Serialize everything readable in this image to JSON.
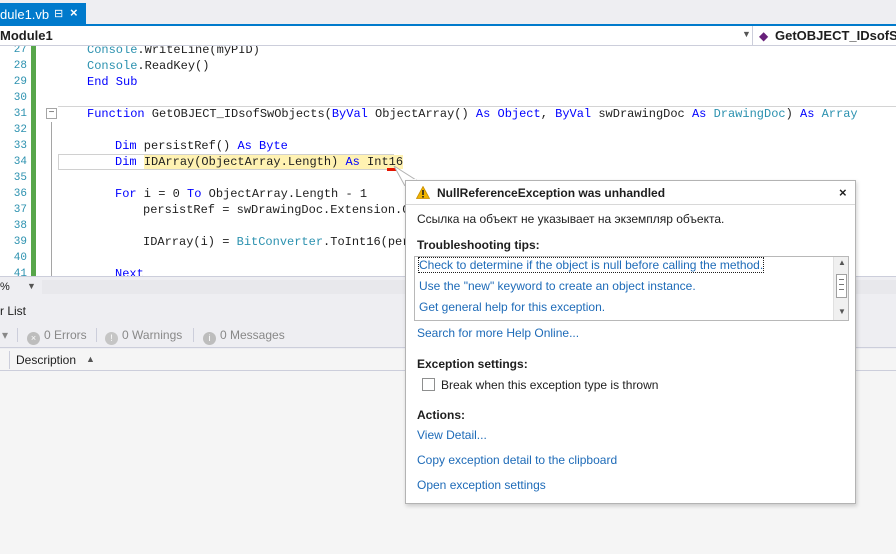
{
  "tab": {
    "title": "dule1.vb",
    "pin": "⊟",
    "close": "×"
  },
  "navbar": {
    "left": "Module1",
    "right": "GetOBJECT_IDsofSwObjects"
  },
  "line_numbers": [
    "27",
    "28",
    "29",
    "30",
    "31",
    "32",
    "33",
    "34",
    "35",
    "36",
    "37",
    "38",
    "39",
    "40",
    "41"
  ],
  "code": {
    "l27": {
      "a": "Console",
      "b": ".WriteLine(myPID)"
    },
    "l28": {
      "a": "Console",
      "b": ".ReadKey()"
    },
    "l29": {
      "a": "End Sub"
    },
    "l31": {
      "k1": "Function",
      "t1": " GetOBJECT_IDsofSwObjects(",
      "k2": "ByVal",
      "t2": " ObjectArray() ",
      "k3": "As",
      "t3": " ",
      "k4": "Object",
      "t4": ", ",
      "k5": "ByVal",
      "t5": " swDrawingDoc ",
      "k6": "As",
      "t6": " ",
      "ty1": "DrawingDoc",
      "t7": ") ",
      "k7": "As",
      "t8": " ",
      "ty2": "Array"
    },
    "l33": {
      "k1": "Dim",
      "t1": " persistRef() ",
      "k2": "As",
      "t2": " ",
      "k3": "Byte"
    },
    "l34": {
      "k1": "Dim",
      "t1": " ",
      "h1": "IDArray(ObjectArray.Length) ",
      "h2": "As",
      "h3": " Int16"
    },
    "l36": {
      "k1": "For",
      "t1": " i = 0 ",
      "k2": "To",
      "t2": " ObjectArray.Length - 1"
    },
    "l37": {
      "t1": "persistRef = swDrawingDoc.Extension.Ge"
    },
    "l39": {
      "t1": "IDArray(i) = ",
      "ty1": "BitConverter",
      "t2": ".ToInt16(pers"
    },
    "l41": {
      "k1": "Next"
    }
  },
  "zoom": {
    "value": "%"
  },
  "error_list": {
    "title": "r List",
    "errors": "0 Errors",
    "warnings": "0 Warnings",
    "messages": "0 Messages",
    "column_description": "Description"
  },
  "exception": {
    "title": "NullReferenceException was unhandled",
    "message": "Ссылка на объект не указывает на экземпляр объекта.",
    "tips_heading": "Troubleshooting tips:",
    "tips": [
      "Check to determine if the object is null before calling the method.",
      "Use the \"new\" keyword to create an object instance.",
      "Get general help for this exception."
    ],
    "search_link": "Search for more Help Online...",
    "settings_heading": "Exception settings:",
    "break_label": "Break when this exception type is thrown",
    "actions_heading": "Actions:",
    "actions": [
      "View Detail...",
      "Copy exception detail to the clipboard",
      "Open exception settings"
    ]
  },
  "colors": {
    "accent": "#007acc",
    "link": "#1e6bb8",
    "keyword": "#0000ff",
    "type": "#2b91af",
    "highlight": "#fff2b2",
    "warning": "#f0b400"
  }
}
